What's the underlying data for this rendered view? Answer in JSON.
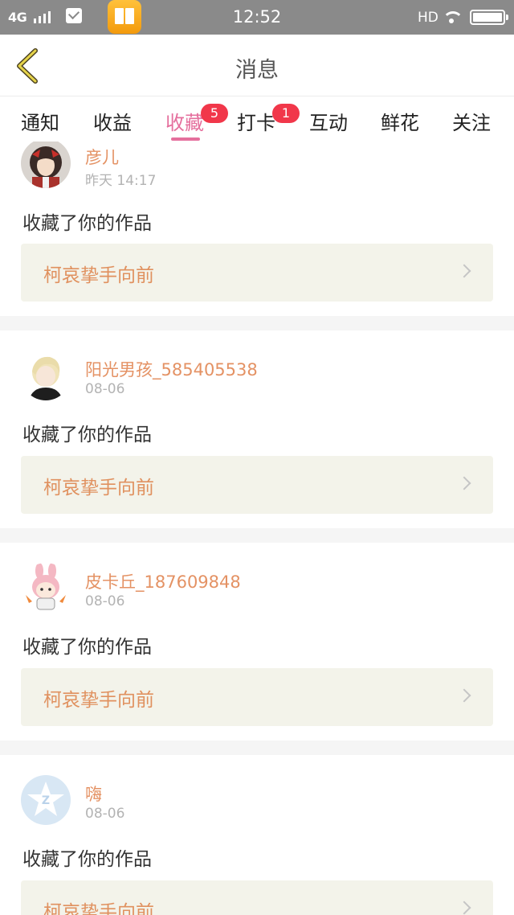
{
  "status_bar": {
    "network": "4G",
    "time": "12:52",
    "hd": "HD"
  },
  "header": {
    "title": "消息"
  },
  "tabs": [
    {
      "label": "通知",
      "active": false
    },
    {
      "label": "收益",
      "active": false
    },
    {
      "label": "收藏",
      "active": true,
      "badge": "5"
    },
    {
      "label": "打卡",
      "active": false,
      "badge": "1"
    },
    {
      "label": "互动",
      "active": false
    },
    {
      "label": "鲜花",
      "active": false
    },
    {
      "label": "关注",
      "active": false
    }
  ],
  "messages": [
    {
      "user": "彦儿",
      "time": "昨天 14:17",
      "text": "收藏了你的作品",
      "work": "柯哀挚手向前",
      "avatar_icon": "girl-avatar-icon"
    },
    {
      "user": "阳光男孩_585405538",
      "time": "08-06",
      "text": "收藏了你的作品",
      "work": "柯哀挚手向前",
      "avatar_icon": "boy-avatar-icon"
    },
    {
      "user": "皮卡丘_187609848",
      "time": "08-06",
      "text": "收藏了你的作品",
      "work": "柯哀挚手向前",
      "avatar_icon": "bunny-avatar-icon"
    },
    {
      "user": "嗨",
      "time": "08-06",
      "text": "收藏了你的作品",
      "work": "柯哀挚手向前",
      "avatar_icon": "qq-star-avatar-icon"
    }
  ],
  "colors": {
    "accent": "#e56f9d",
    "badge": "#f1374a",
    "username": "#e49264",
    "work_bg": "#f3f3ea"
  }
}
